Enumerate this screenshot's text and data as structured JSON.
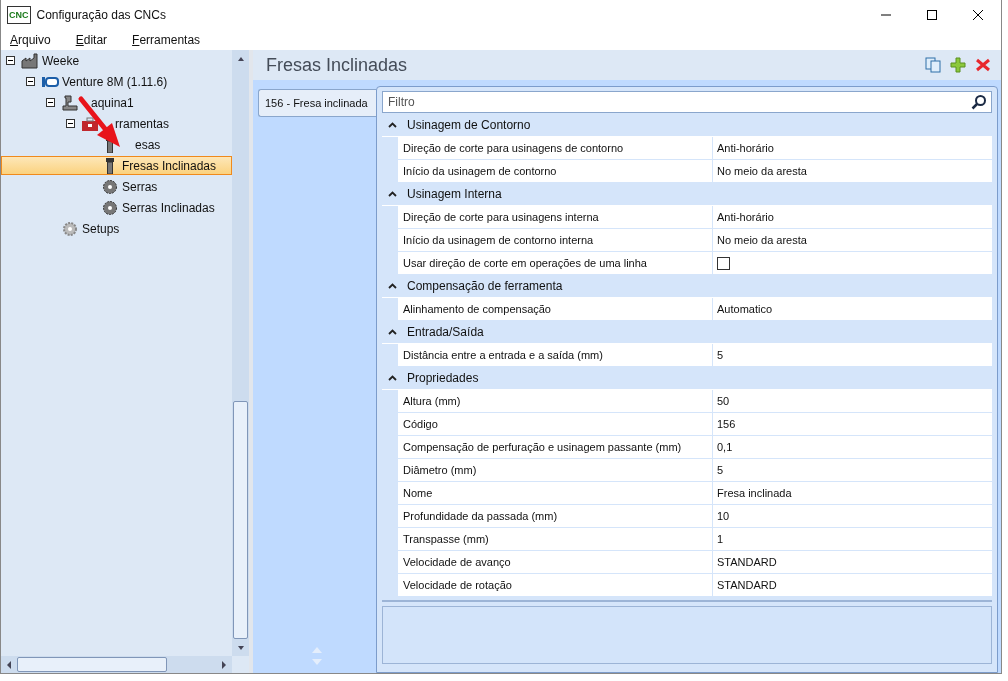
{
  "window": {
    "title": "Configuração das CNCs",
    "logo_text": "CNC"
  },
  "menu": [
    {
      "label": "Arquivo"
    },
    {
      "label": "Editar"
    },
    {
      "label": "Ferramentas"
    }
  ],
  "tree": [
    {
      "label": "Weeke",
      "kind": "factory",
      "expanded": true,
      "selected": false,
      "children": [
        {
          "label": "Venture 8M (1.11.6)",
          "kind": "machine",
          "expanded": true,
          "selected": false,
          "children": [
            {
              "label": "aquina1",
              "kind": "press",
              "expanded": true,
              "selected": false,
              "children": [
                {
                  "label": "rramentas",
                  "kind": "toolbox",
                  "expanded": true,
                  "selected": false,
                  "children": [
                    {
                      "label": "esas",
                      "kind": "cutter",
                      "selected": false
                    },
                    {
                      "label": "Fresas Inclinadas",
                      "kind": "cutter",
                      "selected": true
                    },
                    {
                      "label": "Serras",
                      "kind": "saw",
                      "selected": false
                    },
                    {
                      "label": "Serras Inclinadas",
                      "kind": "saw",
                      "selected": false
                    }
                  ]
                }
              ]
            },
            {
              "label": "Setups",
              "kind": "gear",
              "selected": false
            }
          ]
        }
      ]
    }
  ],
  "heading": "Fresas Inclinadas",
  "tabs": [
    {
      "label": "156 - Fresa inclinada",
      "selected": true
    }
  ],
  "filter": {
    "placeholder": "Filtro"
  },
  "categories": [
    {
      "name": "Usinagem de Contorno",
      "expanded": true,
      "rows": [
        {
          "kind": "text",
          "name": "Direção de corte para usinagens de contorno",
          "value": "Anti-horário"
        },
        {
          "kind": "text",
          "name": "Início da usinagem de contorno",
          "value": "No meio da aresta"
        }
      ]
    },
    {
      "name": "Usinagem Interna",
      "expanded": true,
      "rows": [
        {
          "kind": "text",
          "name": "Direção de corte para usinagens interna",
          "value": "Anti-horário"
        },
        {
          "kind": "text",
          "name": "Início da usinagem de contorno interna",
          "value": "No meio da aresta"
        },
        {
          "kind": "checkbox",
          "name": "Usar direção de corte em operações de uma linha",
          "checked": false
        }
      ]
    },
    {
      "name": "Compensação de ferramenta",
      "expanded": true,
      "rows": [
        {
          "kind": "text",
          "name": "Alinhamento de compensação",
          "value": "Automatico"
        }
      ]
    },
    {
      "name": "Entrada/Saída",
      "expanded": true,
      "rows": [
        {
          "kind": "text",
          "name": "Distância entre a entrada e a saída (mm)",
          "value": "5"
        }
      ]
    },
    {
      "name": "Propriedades",
      "expanded": true,
      "rows": [
        {
          "kind": "text",
          "name": "Altura (mm)",
          "value": "50"
        },
        {
          "kind": "text",
          "name": "Código",
          "value": "156"
        },
        {
          "kind": "text",
          "name": "Compensação de perfuração e usinagem passante (mm)",
          "value": "0,1"
        },
        {
          "kind": "text",
          "name": "Diâmetro (mm)",
          "value": "5"
        },
        {
          "kind": "text",
          "name": "Nome",
          "value": "Fresa inclinada"
        },
        {
          "kind": "text",
          "name": "Profundidade da passada (mm)",
          "value": "10"
        },
        {
          "kind": "text",
          "name": "Transpasse (mm)",
          "value": "1"
        },
        {
          "kind": "text",
          "name": "Velocidade de avanço",
          "value": "STANDARD"
        },
        {
          "kind": "text",
          "name": "Velocidade de rotação",
          "value": "STANDARD"
        }
      ]
    }
  ]
}
